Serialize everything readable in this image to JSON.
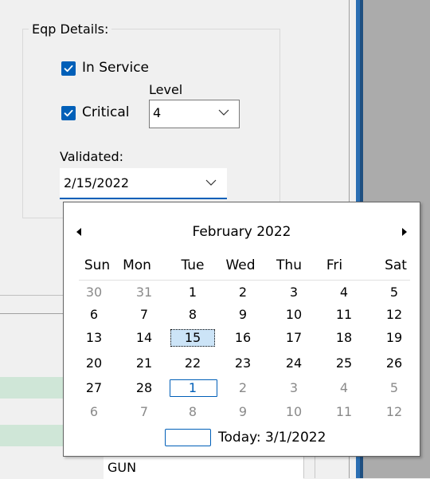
{
  "group": {
    "title": "Eqp Details:"
  },
  "in_service": {
    "label": "In Service",
    "checked": true
  },
  "critical": {
    "label": "Critical",
    "checked": true
  },
  "level": {
    "label": "Level",
    "value": "4"
  },
  "validated": {
    "label": "Validated:",
    "value": "2/15/2022"
  },
  "grid": {
    "cell_text": "GUN"
  },
  "calendar": {
    "month_title": "February 2022",
    "days_of_week": [
      "Sun",
      "Mon",
      "Tue",
      "Wed",
      "Thu",
      "Fri",
      "Sat"
    ],
    "weeks": [
      [
        "30",
        "31",
        "1",
        "2",
        "3",
        "4",
        "5"
      ],
      [
        "6",
        "7",
        "8",
        "9",
        "10",
        "11",
        "12"
      ],
      [
        "13",
        "14",
        "15",
        "16",
        "17",
        "18",
        "19"
      ],
      [
        "20",
        "21",
        "22",
        "23",
        "24",
        "25",
        "26"
      ],
      [
        "27",
        "28",
        "1",
        "2",
        "3",
        "4",
        "5"
      ],
      [
        "6",
        "7",
        "8",
        "9",
        "10",
        "11",
        "12"
      ]
    ],
    "selected_day": "15",
    "today_label": "Today: 3/1/2022"
  },
  "colors": {
    "accent": "#005fb8",
    "selection": "#cce4f7",
    "grid_row_highlight": "#cfe6d7",
    "window_border": "#2b6fb3"
  }
}
